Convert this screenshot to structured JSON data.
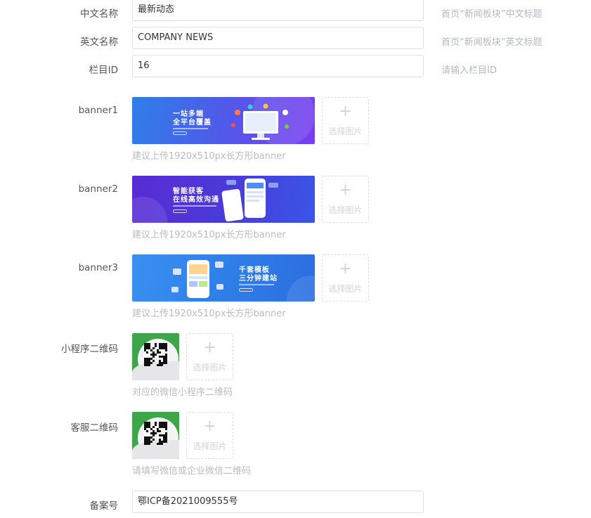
{
  "fields": {
    "cn_name": {
      "label": "中文名称",
      "value": "最新动态",
      "hint": "首页“新闻板块”中文标题"
    },
    "en_name": {
      "label": "英文名称",
      "value": "COMPANY NEWS",
      "hint": "首页“新闻板块”英文标题"
    },
    "column_id": {
      "label": "栏目ID",
      "value": "16",
      "hint": "请输入栏目ID"
    }
  },
  "banners": [
    {
      "label": "banner1",
      "title_line1": "一站多端",
      "title_line2": "全平台覆盖",
      "tip": "建议上传1920x510px长方形banner"
    },
    {
      "label": "banner2",
      "title_line1": "智能获客",
      "title_line2": "在线高效沟通",
      "tip": "建议上传1920x510px长方形banner"
    },
    {
      "label": "banner3",
      "title_line1": "千套模板",
      "title_line2": "三分钟建站",
      "tip": "建议上传1920x510px长方形banner"
    }
  ],
  "upload": {
    "plus": "+",
    "label": "选择图片"
  },
  "qrcodes": {
    "miniprogram": {
      "label": "小程序二维码",
      "tip": "对应的微信小程序二维码"
    },
    "service": {
      "label": "客服二维码",
      "tip": "请填写微信或企业微信二维码"
    }
  },
  "icp": {
    "label": "备案号",
    "value": "鄂ICP备2021009555号"
  },
  "colors": {
    "qr_green": "#3da54a",
    "hint_gray": "#b4b8bf",
    "border": "#dcdfe6"
  }
}
